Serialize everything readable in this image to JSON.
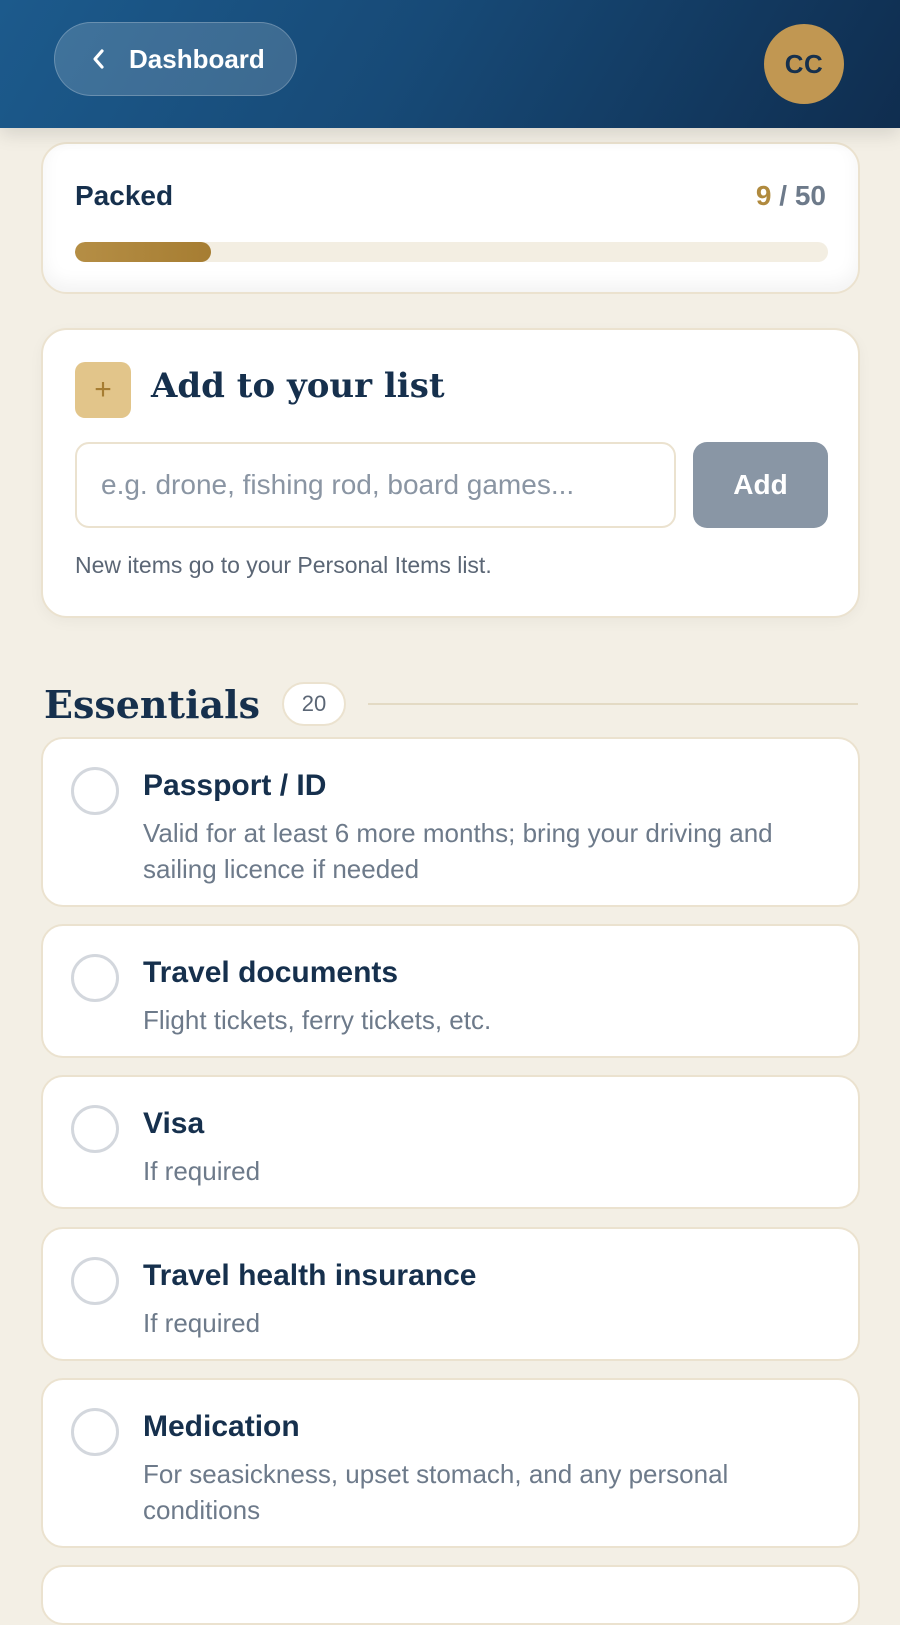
{
  "header": {
    "back_label": "Dashboard",
    "avatar_initials": "CC"
  },
  "progress": {
    "label": "Packed",
    "packed": "9",
    "separator": "/",
    "total": "50",
    "fraction": 0.18
  },
  "add_item": {
    "title": "Add to your list",
    "placeholder": "e.g. drone, fishing rod, board games...",
    "button_label": "Add",
    "hint": "New items go to your Personal Items list."
  },
  "section": {
    "title": "Essentials",
    "count": "20"
  },
  "items": [
    {
      "title": "Passport / ID",
      "desc": "Valid for at least 6 more months; bring your driving and sailing licence if needed"
    },
    {
      "title": "Travel documents",
      "desc": "Flight tickets, ferry tickets, etc."
    },
    {
      "title": "Visa",
      "desc": "If required"
    },
    {
      "title": "Travel health insurance",
      "desc": "If required"
    },
    {
      "title": "Medication",
      "desc": "For seasickness, upset stomach, and any personal conditions"
    }
  ],
  "colors": {
    "header_start": "#1c5a8c",
    "header_end": "#0f2d4f",
    "gold": "#c19752",
    "background": "#f3efe5",
    "navy_text": "#16304d"
  }
}
